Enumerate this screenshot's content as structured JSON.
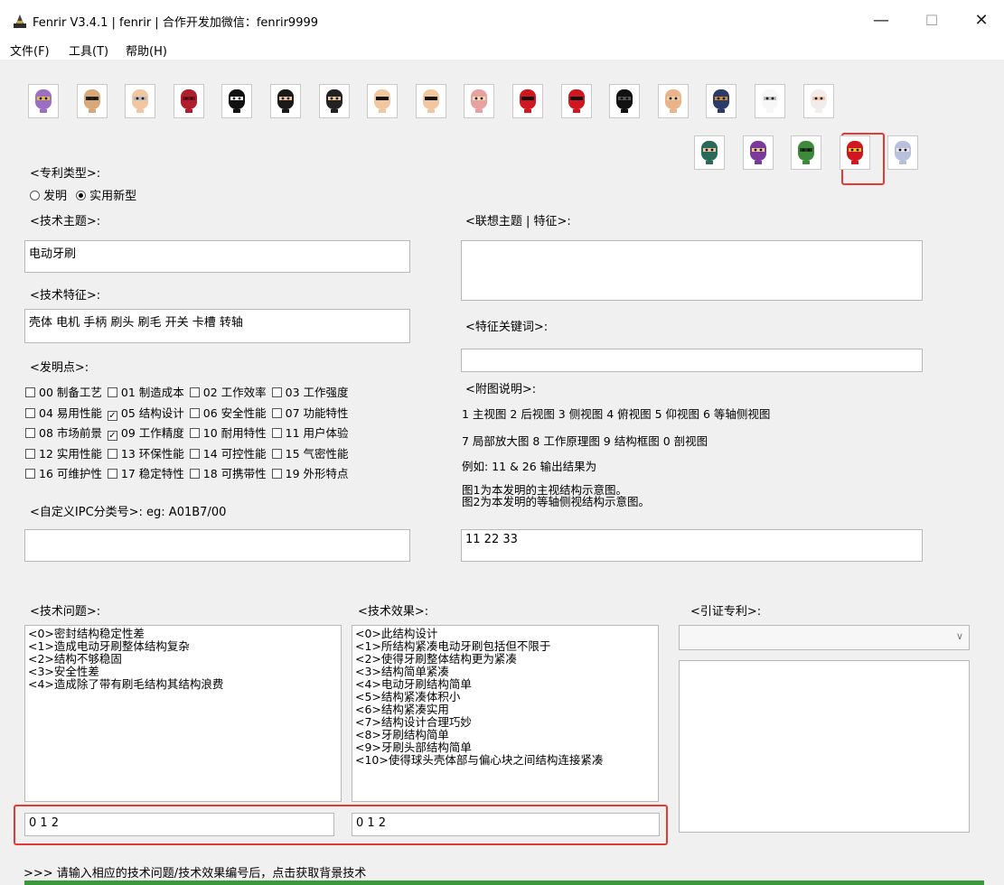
{
  "window": {
    "title": "Fenrir V3.4.1 | fenrir | 合作开发加微信：fenrir9999",
    "minimize": "—",
    "maximize": "☐",
    "close": "✕"
  },
  "menu": [
    "文件(F)",
    "工具(T)",
    "帮助(H)"
  ],
  "heroes_row1": [
    {
      "icon": "thanos-mask-icon",
      "face": "#9c6fc6",
      "accent": "#e6c23c"
    },
    {
      "icon": "heisenberg-mask-icon",
      "face": "#d9a878",
      "accent": "#222222"
    },
    {
      "icon": "thor-mask-icon",
      "face": "#f2c7a0",
      "accent": "#b0b8c8"
    },
    {
      "icon": "magneto-mask-icon",
      "face": "#b01e2e",
      "accent": "#7a0f1a"
    },
    {
      "icon": "ghost-face-mask-icon",
      "face": "#111111",
      "accent": "#ffffff"
    },
    {
      "icon": "batman-mask-icon",
      "face": "#1a1a1a",
      "accent": "#f2c7a0"
    },
    {
      "icon": "wonder-woman-mask-icon",
      "face": "#222222",
      "accent": "#f2c7a0"
    },
    {
      "icon": "superman-mask-icon",
      "face": "#f2c7a0",
      "accent": "#111111"
    },
    {
      "icon": "robin-mask-icon",
      "face": "#f2c7a0",
      "accent": "#111111"
    },
    {
      "icon": "flash-mask-icon",
      "face": "#e8a0a0",
      "accent": "#f3e3b0"
    },
    {
      "icon": "deadpool-mask-icon",
      "face": "#d0161e",
      "accent": "#111111"
    },
    {
      "icon": "spiderman-mask-icon",
      "face": "#d0161e",
      "accent": "#111111"
    },
    {
      "icon": "black-panther-mask-icon",
      "face": "#111111",
      "accent": "#555555"
    },
    {
      "icon": "ironman-faded-mask-icon",
      "face": "#eab38a",
      "accent": "#e9d3a5"
    },
    {
      "icon": "deathstroke-mask-icon",
      "face": "#2b3b6a",
      "accent": "#d88b2a"
    },
    {
      "icon": "anonymous-mask-icon",
      "face": "#f7f7f7",
      "accent": "#bdbdbd"
    },
    {
      "icon": "harley-mask-icon",
      "face": "#f2ecec",
      "accent": "#f2c7a0"
    }
  ],
  "heroes_row2": [
    {
      "icon": "two-face-mask-icon",
      "face": "#2a6a5a",
      "accent": "#f2c7a0"
    },
    {
      "icon": "hawkeye-mask-icon",
      "face": "#7a3a9a",
      "accent": "#f2c7a0"
    },
    {
      "icon": "hulk-mask-icon",
      "face": "#3f8a3a",
      "accent": "#1e3e1e"
    },
    {
      "icon": "ironman-mask-icon",
      "face": "#d0161e",
      "accent": "#f2c02c"
    },
    {
      "icon": "captain-america-mask-icon",
      "face": "#b9c0dc",
      "accent": "#e6e6f2"
    }
  ],
  "selected_hero_color": "#e53935",
  "patent_type": {
    "label": "<专利类型>:",
    "options": [
      {
        "label": "发明",
        "checked": false
      },
      {
        "label": "实用新型",
        "checked": true
      }
    ]
  },
  "tech_topic": {
    "label": "<技术主题>:",
    "value": "电动牙刷"
  },
  "tech_features": {
    "label": "<技术特征>:",
    "value": "壳体 电机 手柄 刷头 刷毛 开关 卡槽 转轴"
  },
  "invention_points": {
    "label": "<发明点>:",
    "rows": [
      [
        {
          "t": "00 制备工艺",
          "c": false
        },
        {
          "t": "01 制造成本",
          "c": false
        },
        {
          "t": "02 工作效率",
          "c": false
        },
        {
          "t": "03 工作强度",
          "c": false
        }
      ],
      [
        {
          "t": "04 易用性能",
          "c": false
        },
        {
          "t": "05 结构设计",
          "c": true
        },
        {
          "t": "06 安全性能",
          "c": false
        },
        {
          "t": "07 功能特性",
          "c": false
        }
      ],
      [
        {
          "t": "08 市场前景",
          "c": false
        },
        {
          "t": "09 工作精度",
          "c": true
        },
        {
          "t": "10 耐用特性",
          "c": false
        },
        {
          "t": "11 用户体验",
          "c": false
        }
      ],
      [
        {
          "t": "12 实用性能",
          "c": false
        },
        {
          "t": "13 环保性能",
          "c": false
        },
        {
          "t": "14 可控性能",
          "c": false
        },
        {
          "t": "15 气密性能",
          "c": false
        }
      ],
      [
        {
          "t": "16 可维护性",
          "c": false
        },
        {
          "t": "17 稳定特性",
          "c": false
        },
        {
          "t": "18 可携带性",
          "c": false
        },
        {
          "t": "19 外形特点",
          "c": false
        }
      ]
    ]
  },
  "ipc": {
    "label": "<自定义IPC分类号>:  eg: A01B7/00",
    "value": ""
  },
  "assoc_topic": {
    "label": "<联想主题 | 特征>:",
    "value": ""
  },
  "feature_keywords": {
    "label": "<特征关键词>:",
    "value": ""
  },
  "figure_desc": {
    "label": "<附图说明>:",
    "line1": "1 主视图 2 后视图 3 侧视图 4 俯视图 5 仰视图 6 等轴侧视图",
    "line2": "7 局部放大图 8 工作原理图 9 结构框图 0 剖视图",
    "example": "例如: 11 & 26 输出结果为",
    "result1": "图1为本发明的主视结构示意图。",
    "result2": "图2为本发明的等轴侧视结构示意图。",
    "input": "11 22 33"
  },
  "tech_problem": {
    "label": "<技术问题>:",
    "items": [
      "<0>密封结构稳定性差",
      "<1>造成电动牙刷整体结构复杂",
      "<2>结构不够稳固",
      "<3>安全性差",
      "<4>造成除了带有刷毛结构其结构浪费"
    ],
    "input": "0 1 2"
  },
  "tech_effect": {
    "label": "<技术效果>:",
    "items": [
      "<0>此结构设计",
      "<1>所结构紧凑电动牙刷包括但不限于",
      "<2>使得牙刷整体结构更为紧凑",
      "<3>结构简单紧凑",
      "<4>电动牙刷结构简单",
      "<5>结构紧凑体积小",
      "<6>结构紧凑实用",
      "<7>结构设计合理巧妙",
      "<8>牙刷结构简单",
      "<9>牙刷头部结构简单",
      "<10>使得球头壳体部与偏心块之间结构连接紧凑"
    ],
    "input": "0 1 2"
  },
  "cited_patent": {
    "label": "<引证专利>:",
    "dropdown": ""
  },
  "status": ">>> 请输入相应的技术问题/技术效果编号后，点击获取背景技术"
}
